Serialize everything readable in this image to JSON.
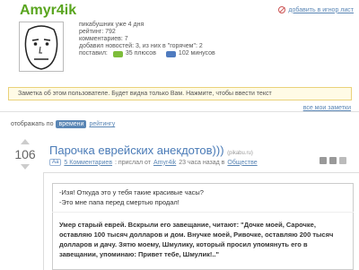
{
  "profile": {
    "username": "Amyr4ik",
    "ignore_label": "добавить в игнор лист",
    "stats": {
      "member_since": "пикабушник уже 4 дня",
      "rating": "рейтинг: 792",
      "comments": "комментариев: 7",
      "posts": "добавил новостей: 3, из них в \"горячем\": 2",
      "votes_prefix": "поставил:",
      "plus": "35 плюсов",
      "minus": "102 минусов"
    }
  },
  "note": {
    "text": "Заметка об этом пользователе. Будет видна только Вам. Нажмите, чтобы ввести текст",
    "my_notes_link": "все мои заметки"
  },
  "sorting": {
    "label": "отображать по",
    "options": [
      "времени",
      "рейтингу"
    ],
    "active": "времени"
  },
  "post": {
    "score": "106",
    "title": "Парочка еврейских анекдотов)))",
    "source": "(pikabu.ru)",
    "aa_label": "Аа",
    "comments": "5 Комментариев",
    "sent_from": ": прислал от",
    "author": "Amyr4ik",
    "time": "23 часа назад в",
    "category": "Обществе",
    "joke1_line1": "-Изя! Откуда это у тебя такие красивые часы?",
    "joke1_line2": "-Это мне папа перед смертью продал!",
    "joke2": "Умер старый еврей. Вскрыли его завещание, читают: \"Дочке моей, Сарочке, оставляю 100 тысяч долларов и дом. Внучке моей, Ривочке, оставляю 200 тысяч долларов и дачу. Зятю моему, Шмулику, который просил упомянуть его в завещании, упоминаю: Привет тебе, Шмулик!..\""
  },
  "colors": {
    "username": "#59a51e",
    "link": "#5a86b5",
    "title": "#4a7bb7",
    "note_bg": "#fffbe6"
  }
}
